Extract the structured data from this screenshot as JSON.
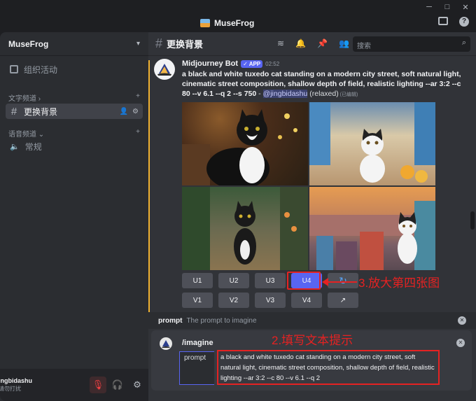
{
  "app": {
    "title": "MuseFrog",
    "window_controls": [
      "─",
      "□",
      "✕"
    ]
  },
  "sidebar": {
    "server_name": "MuseFrog",
    "events_label": "组织活动",
    "text_category": "文字频道",
    "text_channel": "更换背景",
    "voice_category": "语音频道",
    "voice_channel": "常规"
  },
  "user": {
    "name": "ingbidashu",
    "status": "请勿打扰"
  },
  "channel": {
    "name": "更换背景",
    "search_placeholder": "搜索"
  },
  "message": {
    "author": "Midjourney Bot",
    "badge": "✓ APP",
    "time": "02:52",
    "prompt": "a black and white tuxedo cat standing on a modern city street, soft natural light, cinematic street composition, shallow depth of field, realistic lighting --ar 3:2 --c 80 --v 6.1 --q 2 --s 750",
    "separator": " - ",
    "mention": "@jingbidashu",
    "mode": " (relaxed)",
    "edited": " (已编辑)"
  },
  "buttons": {
    "row1": [
      "U1",
      "U2",
      "U3",
      "U4",
      "↻"
    ],
    "row2": [
      "V1",
      "V2",
      "V3",
      "V4",
      "↗"
    ]
  },
  "annotations": {
    "step3": "3.放大第四张图",
    "step2": "2.填写文本提示"
  },
  "command": {
    "name": "prompt",
    "description": "The prompt to imagine",
    "slash": "/imagine",
    "field_label": "prompt",
    "field_value": "a black and white tuxedo cat standing on a modern city street, soft natural light, cinematic street composition, shallow depth of field, realistic lighting --ar 3:2 --c 80 --v 6.1 --q 2"
  },
  "colors": {
    "accent": "#5865f2",
    "annotation": "#e52222",
    "highlight": "#f0b232"
  }
}
